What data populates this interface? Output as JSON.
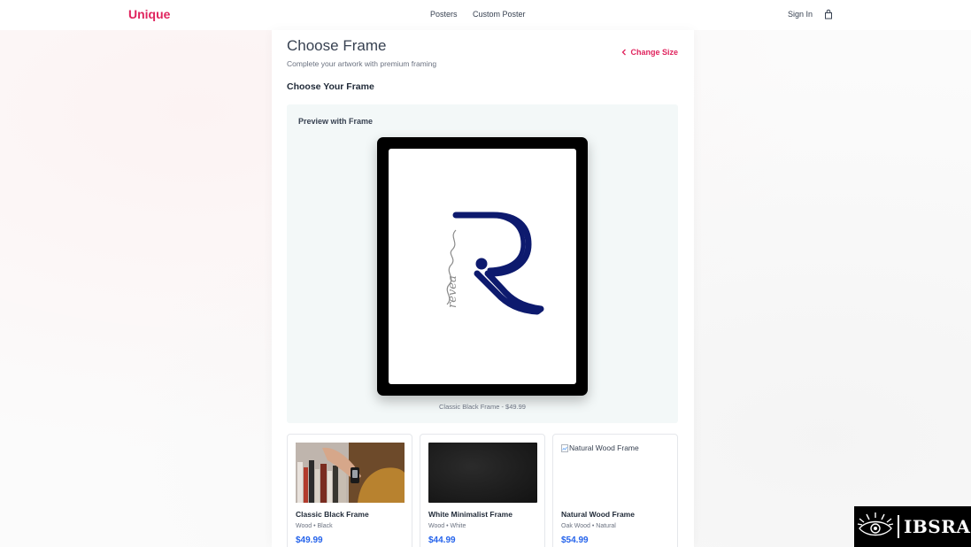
{
  "nav": {
    "brand": "Unique",
    "links": [
      "Posters",
      "Custom Poster"
    ],
    "sign_in": "Sign In",
    "cart_icon": "shopping-bag-icon"
  },
  "page": {
    "title": "Choose Frame",
    "subtitle": "Complete your artwork with premium framing",
    "change_size": "Change Size",
    "section_title": "Choose Your Frame"
  },
  "preview": {
    "title": "Preview with Frame",
    "caption": "Classic Black Frame - $49.99",
    "artwork_letter": "R",
    "artwork_script": "revea"
  },
  "frames": [
    {
      "name": "Classic Black Frame",
      "meta": "Wood • Black",
      "price": "$49.99",
      "image_alt": ""
    },
    {
      "name": "White Minimalist Frame",
      "meta": "Wood • White",
      "price": "$44.99",
      "image_alt": ""
    },
    {
      "name": "Natural Wood Frame",
      "meta": "Oak Wood • Natural",
      "price": "$54.99",
      "image_alt": "Natural Wood Frame"
    }
  ],
  "watermark": {
    "text": "IBSRA"
  },
  "colors": {
    "brand": "#e0245e",
    "price": "#2563eb",
    "frame": "#000000",
    "logo": "#0d1a6e"
  }
}
